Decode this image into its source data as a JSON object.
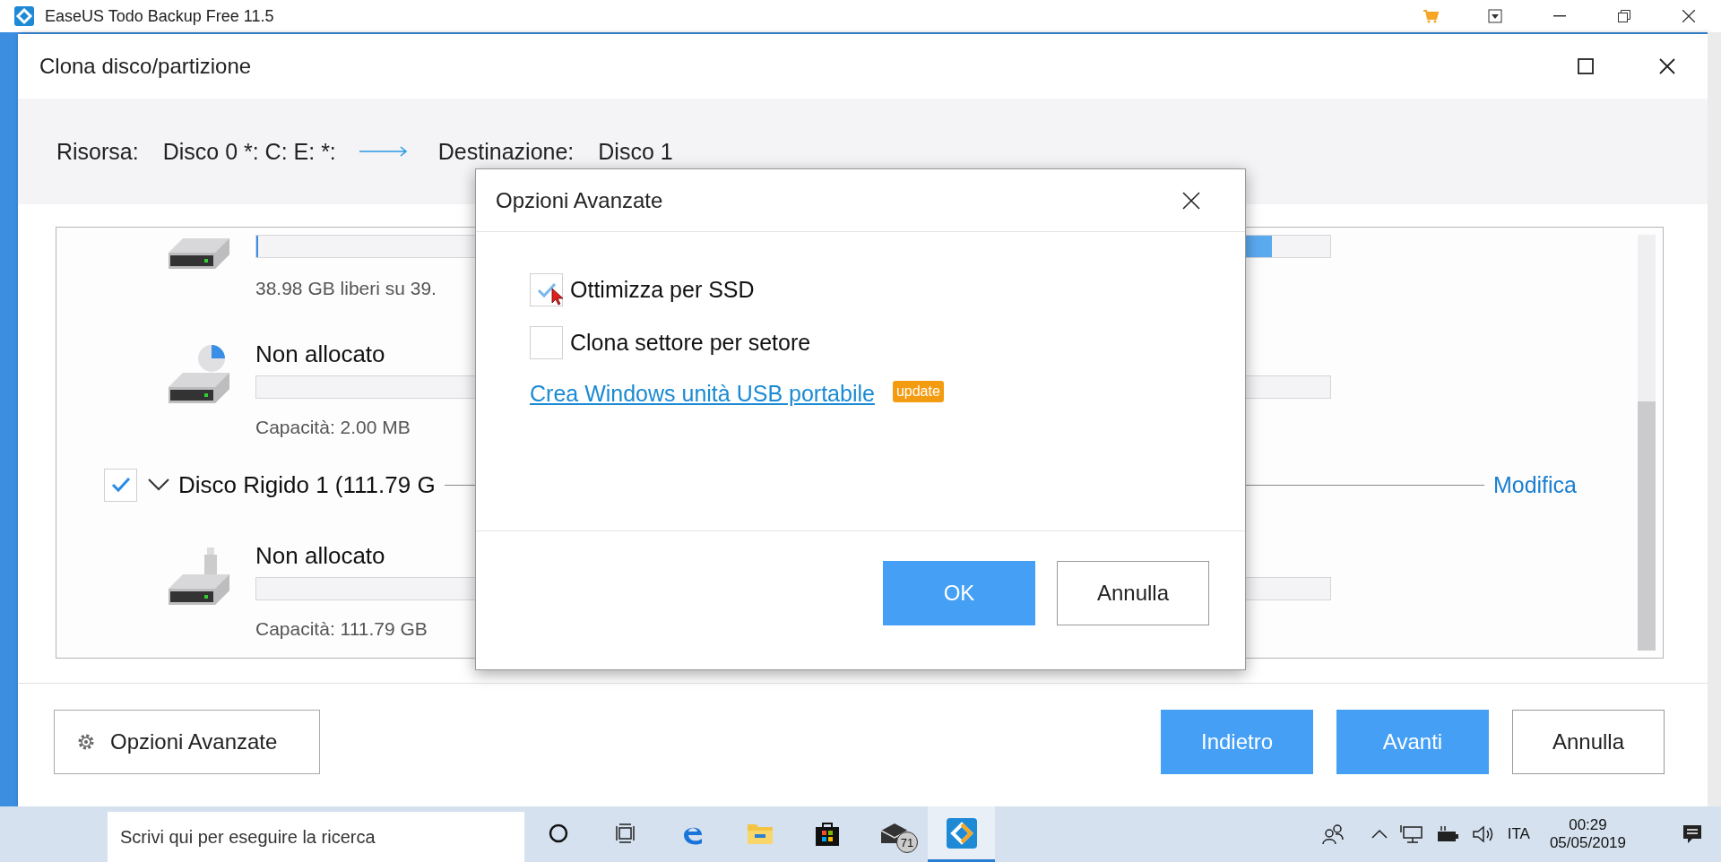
{
  "app_title_bar": {
    "title": "EaseUS Todo Backup Free 11.5"
  },
  "window": {
    "title": "Clona disco/partizione"
  },
  "route": {
    "source_label": "Risorsa:",
    "source": "Disco 0 *: C: E: *:",
    "destination_label": "Destinazione:",
    "destination": "Disco 1"
  },
  "disk_list": {
    "items": [
      {
        "kind": "partition",
        "free_text": "38.98 GB liberi su 39."
      },
      {
        "kind": "partition",
        "name": "Non allocato",
        "capacity": "Capacità: 2.00 MB"
      },
      {
        "kind": "disk",
        "checked": true,
        "expanded": true,
        "name": "Disco Rigido 1 (111.79 G",
        "action": "Modifica"
      },
      {
        "kind": "partition",
        "name": "Non allocato",
        "capacity": "Capacità: 111.79 GB"
      }
    ]
  },
  "advanced_button": {
    "label": "Opzioni Avanzate"
  },
  "nav_buttons": [
    {
      "label": "Indietro",
      "kind": "primary"
    },
    {
      "label": "Avanti",
      "kind": "primary"
    },
    {
      "label": "Annulla",
      "kind": "secondary"
    }
  ],
  "dialog": {
    "title": "Opzioni Avanzate",
    "options": [
      {
        "label": "Ottimizza per SSD",
        "checked": true
      },
      {
        "label": "Clona settore per setore",
        "checked": false
      }
    ],
    "link": "Crea Windows unità USB portabile",
    "badge": "update",
    "buttons": [
      {
        "label": "OK",
        "kind": "primary"
      },
      {
        "label": "Annulla",
        "kind": "secondary"
      }
    ]
  },
  "taskbar": {
    "search": {
      "placeholder": "Scrivi qui per eseguire la ricerca"
    },
    "apps": [
      {
        "kind": "edge",
        "selected": false
      },
      {
        "kind": "explorer",
        "selected": false
      },
      {
        "kind": "store",
        "selected": false
      },
      {
        "kind": "mail",
        "selected": false,
        "badge": "71"
      },
      {
        "kind": "easeus",
        "selected": true
      }
    ],
    "language": "ITA",
    "time": "00:29",
    "date": "05/05/2019"
  }
}
